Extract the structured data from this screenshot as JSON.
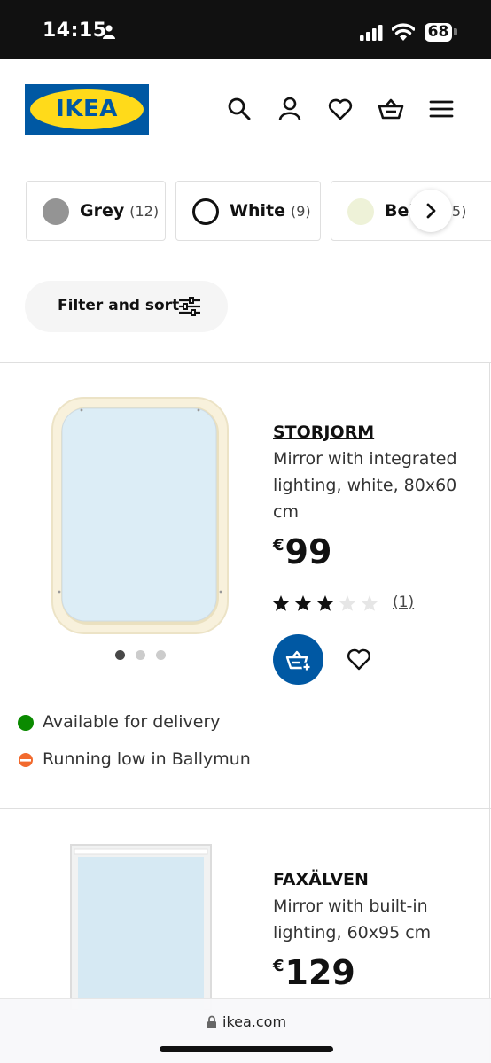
{
  "status_bar": {
    "time": "14:15",
    "battery": "68"
  },
  "header": {
    "logo_text": "IKEA",
    "icons": [
      "search-icon",
      "user-icon",
      "heart-icon",
      "basket-icon",
      "menu-icon"
    ]
  },
  "color_filters": [
    {
      "name": "Grey",
      "count": "(12)",
      "swatch": "#949494"
    },
    {
      "name": "White",
      "count": "(9)",
      "swatch": "#ffffff"
    },
    {
      "name": "Bei",
      "count": "5)",
      "swatch": "#eef2d8"
    }
  ],
  "filter_sort": {
    "label": "Filter and sort"
  },
  "products": [
    {
      "name": "STORJORM",
      "description": "Mirror with integrated lighting, white, 80x60 cm",
      "currency": "€",
      "price": "99",
      "rating": 3,
      "rating_max": 5,
      "reviews": "(1)",
      "image_dots": 3,
      "active_dot": 0,
      "availability": [
        {
          "text": "Available for delivery",
          "color": "#0a8a00"
        },
        {
          "text": "Running low in Ballymun",
          "color": "#f26a2e"
        }
      ]
    },
    {
      "name": "FAXÄLVEN",
      "description": "Mirror with built-in lighting, 60x95 cm",
      "currency": "€",
      "price": "129"
    }
  ],
  "browser": {
    "url": "ikea.com"
  },
  "colors": {
    "ikea_blue": "#0058a3",
    "ikea_yellow": "#ffda1a"
  }
}
